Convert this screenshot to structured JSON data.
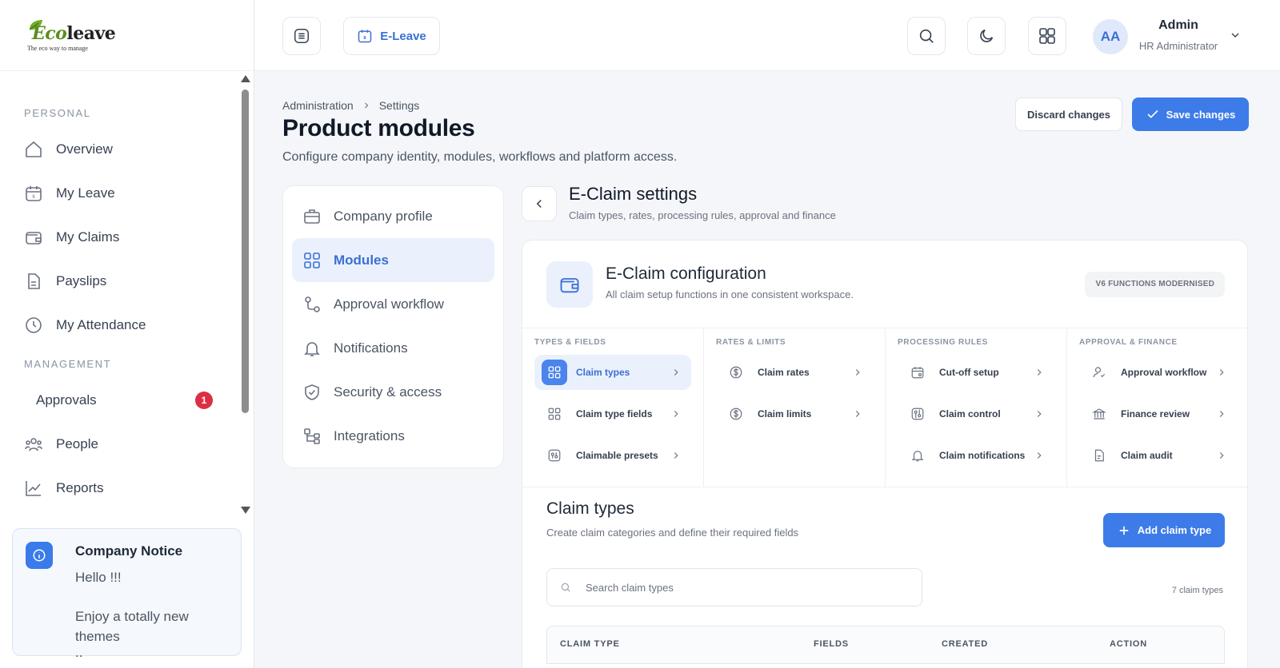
{
  "app": {
    "logo_word_eco": "Eco",
    "logo_word_rest": "leave",
    "logo_tagline": "The eco way to manage"
  },
  "sidebar": {
    "personal_heading": "PERSONAL",
    "personal_items": [
      {
        "label": "Overview",
        "icon": "home-icon"
      },
      {
        "label": "My Leave",
        "icon": "calendar-icon"
      },
      {
        "label": "My Claims",
        "icon": "wallet-icon"
      },
      {
        "label": "Payslips",
        "icon": "document-icon"
      },
      {
        "label": "My Attendance",
        "icon": "clock-icon"
      }
    ],
    "management_heading": "MANAGEMENT",
    "management_items": [
      {
        "label": "Approvals",
        "badge": "1"
      },
      {
        "label": "People",
        "icon": "people-icon"
      },
      {
        "label": "Reports",
        "icon": "chart-line-icon"
      }
    ],
    "notice": {
      "title": "Company Notice",
      "line1": "Hello !!!",
      "line2": "Enjoy a totally new themes",
      "line3": ".."
    }
  },
  "topbar": {
    "module_label": "E-Leave",
    "user_initials": "AA",
    "user_name": "Admin",
    "user_role": "HR Administrator"
  },
  "page": {
    "breadcrumb": [
      "Administration",
      "Settings"
    ],
    "title": "Product modules",
    "subtitle": "Configure company identity, modules, workflows and platform access.",
    "discard_label": "Discard changes",
    "save_label": "Save changes"
  },
  "settings_nav": [
    {
      "label": "Company profile",
      "icon": "briefcase-icon",
      "active": false
    },
    {
      "label": "Modules",
      "icon": "grid-icon",
      "active": true
    },
    {
      "label": "Approval workflow",
      "icon": "workflow-icon",
      "active": false
    },
    {
      "label": "Notifications",
      "icon": "bell-icon",
      "active": false
    },
    {
      "label": "Security & access",
      "icon": "shield-icon",
      "active": false
    },
    {
      "label": "Integrations",
      "icon": "integrations-icon",
      "active": false
    }
  ],
  "panel": {
    "title": "E-Claim settings",
    "subtitle": "Claim types, rates, processing rules, approval and finance"
  },
  "config": {
    "title": "E-Claim configuration",
    "subtitle": "All claim setup functions in one consistent workspace.",
    "pill": "V6 FUNCTIONS MODERNISED",
    "columns": [
      {
        "heading": "TYPES & FIELDS",
        "items": [
          {
            "label": "Claim types",
            "icon": "grid-icon",
            "active": true
          },
          {
            "label": "Claim type fields",
            "icon": "grid-icon",
            "active": false
          },
          {
            "label": "Claimable presets",
            "icon": "preset-icon",
            "active": false
          }
        ]
      },
      {
        "heading": "RATES & LIMITS",
        "items": [
          {
            "label": "Claim rates",
            "icon": "dollar-icon",
            "active": false
          },
          {
            "label": "Claim limits",
            "icon": "dollar-icon",
            "active": false
          }
        ]
      },
      {
        "heading": "PROCESSING RULES",
        "items": [
          {
            "label": "Cut-off setup",
            "icon": "calendar-icon",
            "active": false
          },
          {
            "label": "Claim control",
            "icon": "control-icon",
            "active": false
          },
          {
            "label": "Claim notifications",
            "icon": "bell-icon",
            "active": false
          }
        ]
      },
      {
        "heading": "APPROVAL & FINANCE",
        "items": [
          {
            "label": "Approval workflow",
            "icon": "user-check-icon",
            "active": false
          },
          {
            "label": "Finance review",
            "icon": "bank-icon",
            "active": false
          },
          {
            "label": "Claim audit",
            "icon": "audit-icon",
            "active": false
          }
        ]
      }
    ]
  },
  "claim_types": {
    "title": "Claim types",
    "subtitle": "Create claim categories and define their required fields",
    "add_label": "Add claim type",
    "search_placeholder": "Search claim types",
    "search_value": "",
    "count": "7 claim types",
    "columns": [
      "CLAIM TYPE",
      "FIELDS",
      "CREATED",
      "ACTION"
    ]
  },
  "colors": {
    "accent": "#3d7be9",
    "badge": "#dc2f44",
    "active_bg": "#eaf1fd"
  }
}
